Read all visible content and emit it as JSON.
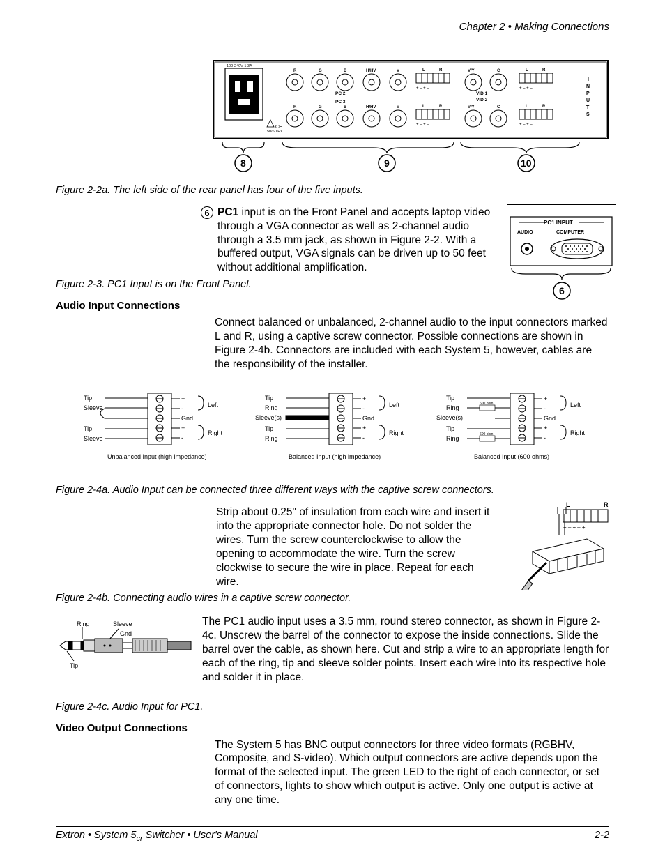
{
  "header": {
    "chapter": "Chapter 2 • Making Connections"
  },
  "rear_panel": {
    "power_label": "100-240V      1.3A",
    "freq_label": "50/60 Hz",
    "row_labels": [
      "R",
      "G",
      "B",
      "H/HV",
      "V",
      "L",
      "R",
      "V/Y",
      "C",
      "L",
      "R"
    ],
    "pc2": "PC 2",
    "pc3": "PC 3",
    "vid1": "VID 1",
    "vid2": "VID 2",
    "vy": "V/Y",
    "polarities": "+ – + –",
    "inputs_label": "INPUTS",
    "callouts": [
      "8",
      "9",
      "10"
    ]
  },
  "captions": {
    "fig22a": "Figure 2-2a. The left side of the rear panel has four of the five inputs.",
    "fig23": "Figure 2-3. PC1 Input is on the Front Panel.",
    "fig24a": "Figure 2-4a. Audio Input can be connected three different ways with the captive screw connectors.",
    "fig24b": "Figure 2-4b. Connecting audio wires in a captive screw connector.",
    "fig24c": "Figure 2-4c. Audio Input for PC1."
  },
  "pc1": {
    "num": "6",
    "bold": "PC1",
    "rest": " input is on the Front Panel and accepts laptop video through a VGA connector as well as 2-channel audio through a 3.5 mm jack, as shown in Figure 2-2. With a buffered output, VGA signals can be driven up to 50 feet without additional amplification.",
    "panel": {
      "title": "PC1 INPUT",
      "audio": "AUDIO",
      "computer": "COMPUTER",
      "callout": "6"
    }
  },
  "headings": {
    "audio_input": "Audio Input Connections",
    "video_output": "Video Output Connections"
  },
  "paras": {
    "audio_intro": "Connect balanced or unbalanced, 2-channel audio to the input connectors marked L and R, using a captive screw connector. Possible connections are shown in Figure 2-4b. Connectors are included with each System 5, however, cables are the responsibility of the installer.",
    "strip": "Strip about 0.25\" of insulation from each wire and insert it into the appropriate connector hole. Do not solder the wires. Turn the screw counterclockwise to allow the opening to accommodate the wire. Turn the screw clockwise to secure the wire in place. Repeat for each wire.",
    "stereo": "The PC1 audio input uses a 3.5 mm, round stereo connector, as shown in Figure 2-4c. Unscrew the barrel of the connector to expose the inside connections. Slide the barrel over the cable, as shown here. Cut and strip a wire to an appropriate length for each of the ring, tip and sleeve solder points. Insert each wire into its respective hole and solder it in place.",
    "video_out": "The System 5 has BNC output connectors for three video formats (RGBHV, Composite, and S-video). Which output connectors are active depends upon the format of the selected input. The green LED to the right of each connector, or set of connectors, lights to show which output is active. Only one output is active at any one time."
  },
  "audio_diagrams": {
    "a": {
      "wires": [
        "Tip",
        "Sleeve",
        "",
        "Tip",
        "Sleeve"
      ],
      "pins": [
        "+",
        "-",
        "Gnd",
        "+",
        "-"
      ],
      "chans": [
        "Left",
        "Right"
      ],
      "cap": "Unbalanced Input (high impedance)"
    },
    "b": {
      "wires": [
        "Tip",
        "Ring",
        "Sleeve(s)",
        "Tip",
        "Ring"
      ],
      "pins": [
        "+",
        "-",
        "Gnd",
        "+",
        "-"
      ],
      "chans": [
        "Left",
        "Right"
      ],
      "cap": "Balanced Input (high impedance)"
    },
    "c": {
      "wires": [
        "Tip",
        "Ring",
        "Sleeve(s)",
        "Tip",
        "Ring"
      ],
      "ohm": "600 ohm",
      "pins": [
        "+",
        "-",
        "Gnd",
        "+",
        "-"
      ],
      "chans": [
        "Left",
        "Right"
      ],
      "cap": "Balanced Input (600 ohms)"
    }
  },
  "wire_fig": {
    "top": "L      R",
    "polarities": "+ –  ÷  – +"
  },
  "stereo_fig": {
    "ring": "Ring",
    "sleeve": "Sleeve",
    "gnd": "Gnd",
    "tip": "Tip"
  },
  "footer": {
    "left_a": "Extron • System 5",
    "left_cr": "cr",
    "left_b": " Switcher • User's Manual",
    "page": "2-2"
  }
}
